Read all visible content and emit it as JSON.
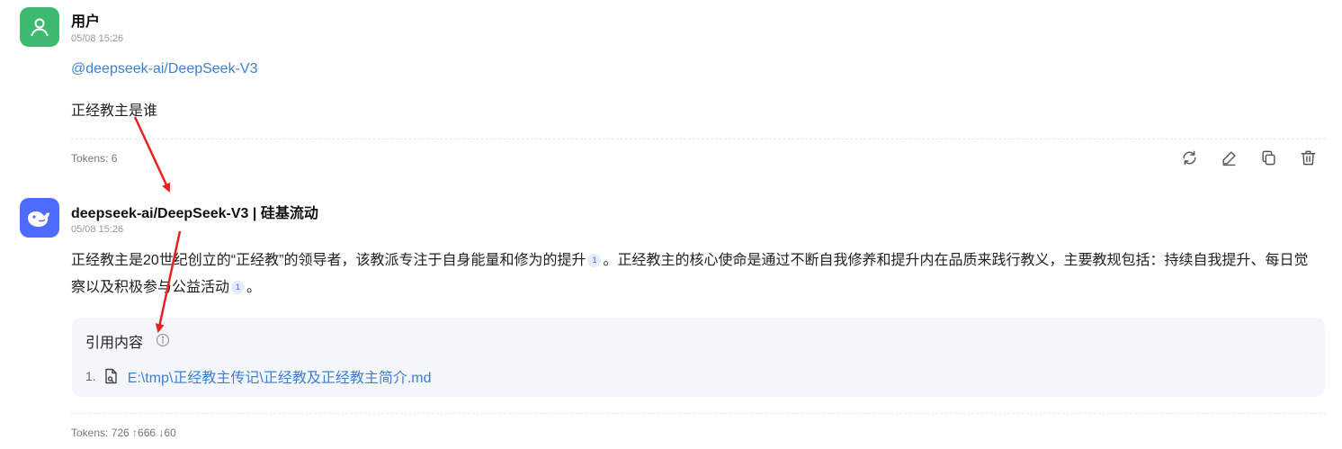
{
  "user_message": {
    "name": "用户",
    "time": "05/08 15:26",
    "mention": "@deepseek-ai/DeepSeek-V3",
    "text": "正经教主是谁",
    "tokens": "Tokens: 6"
  },
  "actions": [
    "refresh-icon",
    "edit-icon",
    "copy-icon",
    "delete-icon"
  ],
  "assistant_message": {
    "name": "deepseek-ai/DeepSeek-V3 | 硅基流动",
    "time": "05/08 15:26",
    "answer": {
      "part1": "正经教主是20世纪创立的“正经教”的领导者，该教派专注于自身能量和修为的提升",
      "cite1": "1",
      "part2": "。正经教主的核心使命是通过不断自我修养和提升内在品质来践行教义，主要教规包括：持续自我提升、每日觉察以及积极参与公益活动",
      "cite2": "1",
      "part3": "。"
    },
    "references": {
      "title": "引用内容",
      "items": [
        {
          "num": "1.",
          "path": "E:\\tmp\\正经教主传记\\正经教及正经教主简介.md"
        }
      ]
    },
    "tokens": "Tokens: 726 ↑666 ↓60"
  },
  "colors": {
    "user_avatar": "#3dba6f",
    "bot_avatar": "#4d6bfe",
    "link": "#3b7fd6",
    "annotation_arrow": "#e8201f"
  }
}
